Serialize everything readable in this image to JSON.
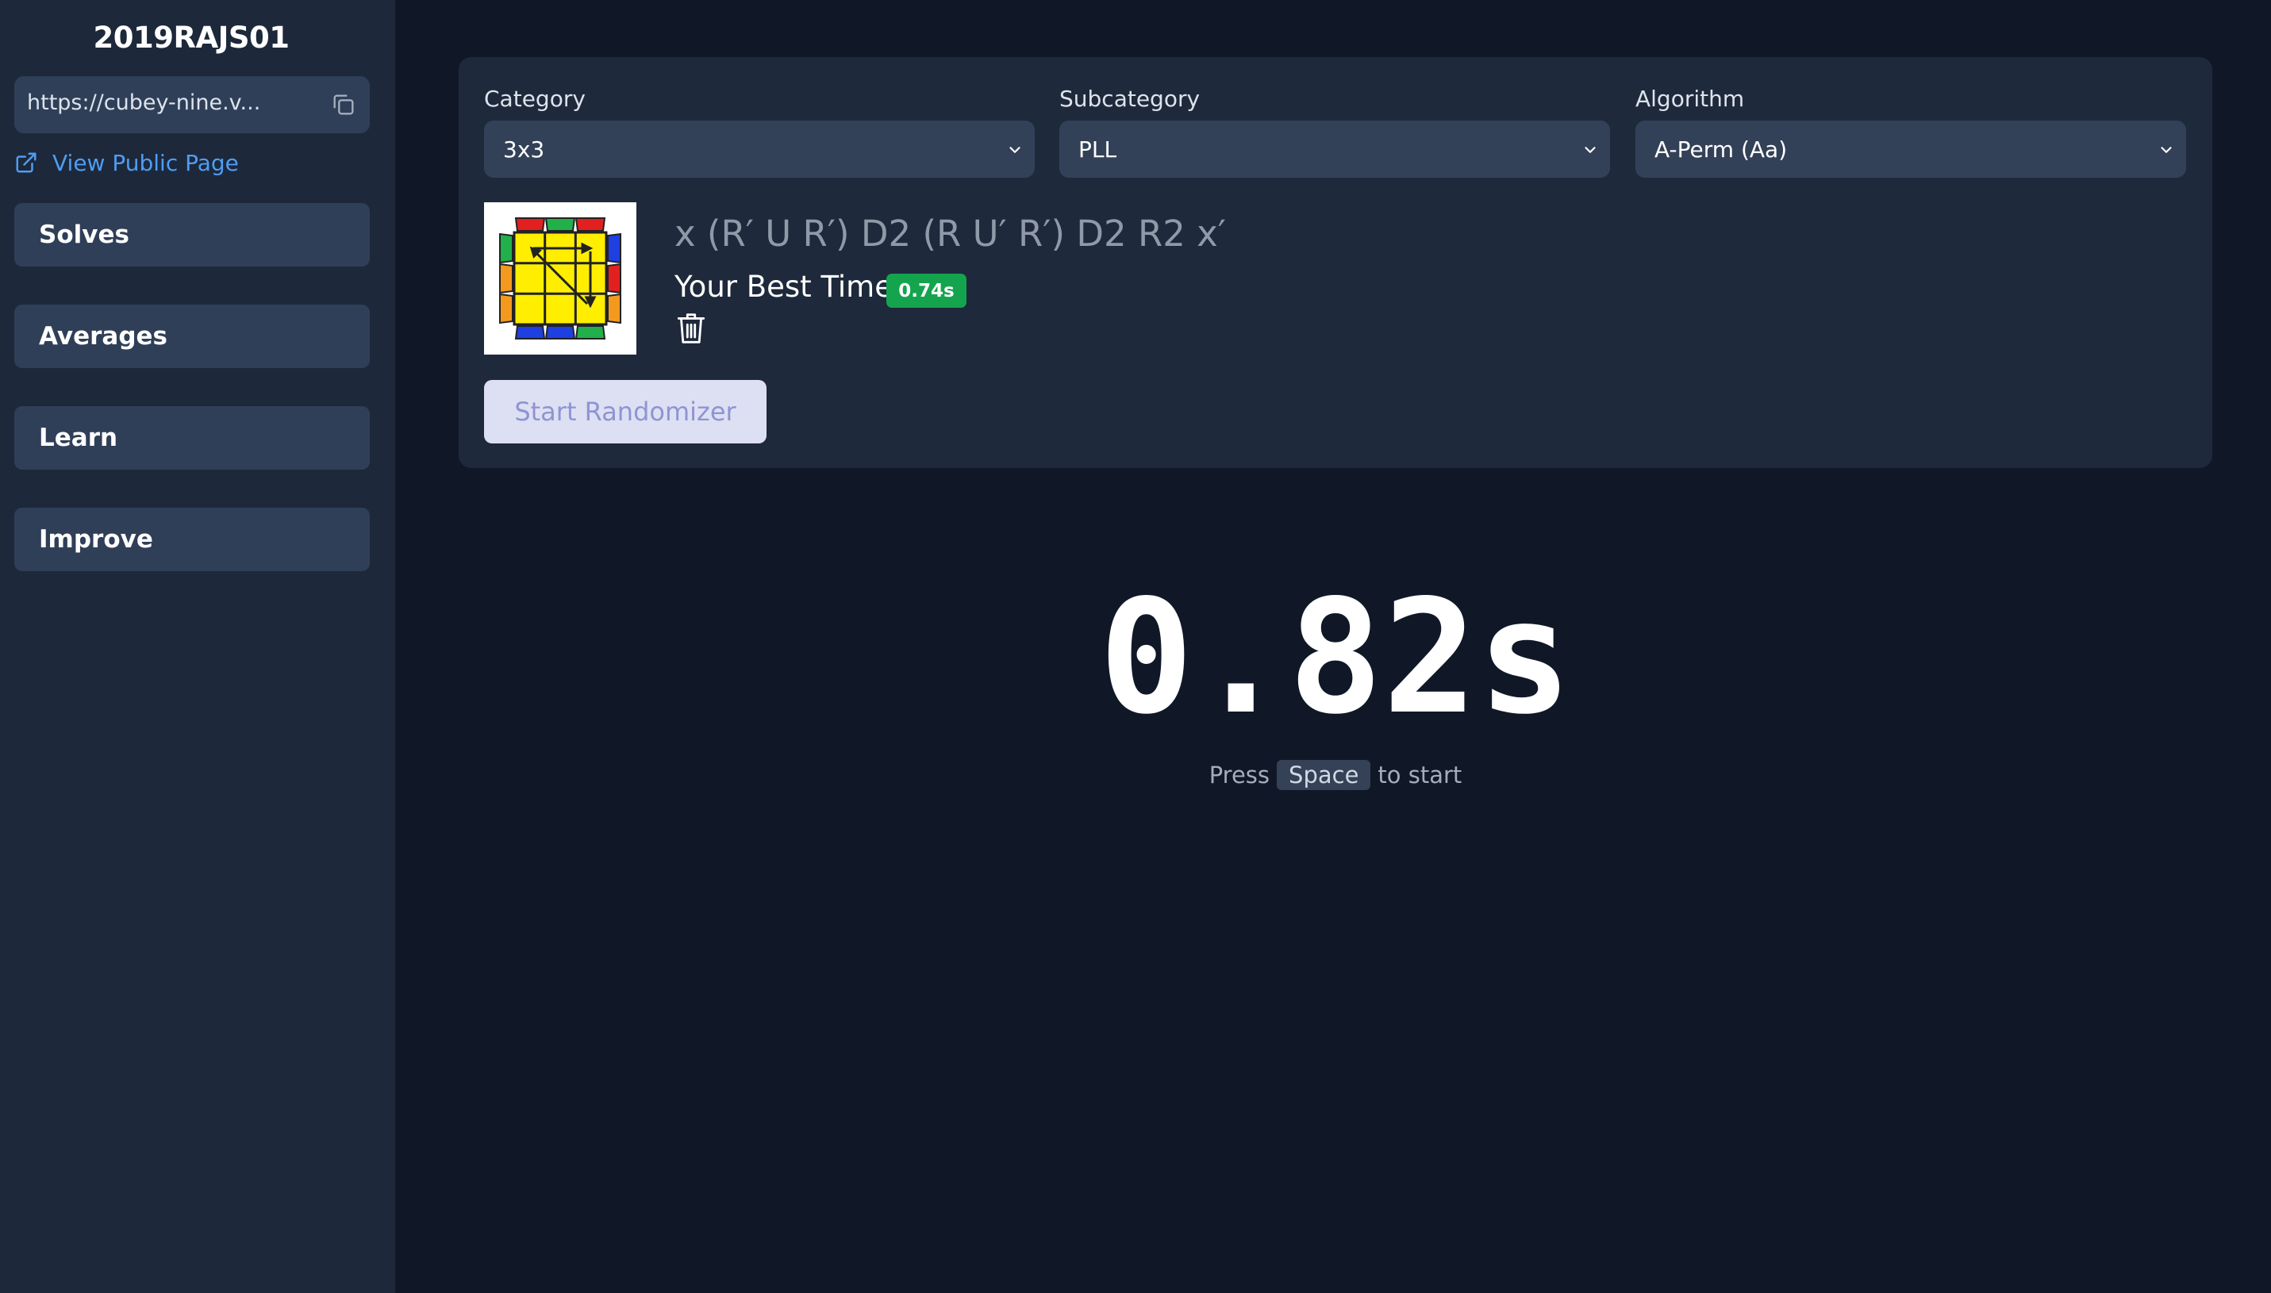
{
  "sidebar": {
    "username": "2019RAJS01",
    "url_display": "https://cubey-nine.v...",
    "public_link_label": "View Public Page",
    "nav": [
      {
        "label": "Solves"
      },
      {
        "label": "Averages"
      },
      {
        "label": "Learn"
      },
      {
        "label": "Improve"
      }
    ]
  },
  "panel": {
    "category": {
      "label": "Category",
      "value": "3x3"
    },
    "subcategory": {
      "label": "Subcategory",
      "value": "PLL"
    },
    "algorithm": {
      "label": "Algorithm",
      "value": "A-Perm (Aa)"
    },
    "alg_notation": "x (R′ U R′) D2 (R U′ R′) D2 R2 x′",
    "best_time_label": "Your Best Time:",
    "best_time_value": "0.74s",
    "randomizer_label": "Start Randomizer"
  },
  "timer": {
    "value": "0.82s",
    "hint_before": "Press",
    "hint_key": "Space",
    "hint_after": "to start"
  },
  "colors": {
    "background": "#101828",
    "sidebar": "#1d283b",
    "panel": "#1e293b",
    "control": "#303f58",
    "link": "#4e9df2",
    "badge_green": "#14a44d"
  },
  "icons": [
    "copy-icon",
    "external-link-icon",
    "chevron-down-icon",
    "trash-icon",
    "cube-diagram"
  ]
}
